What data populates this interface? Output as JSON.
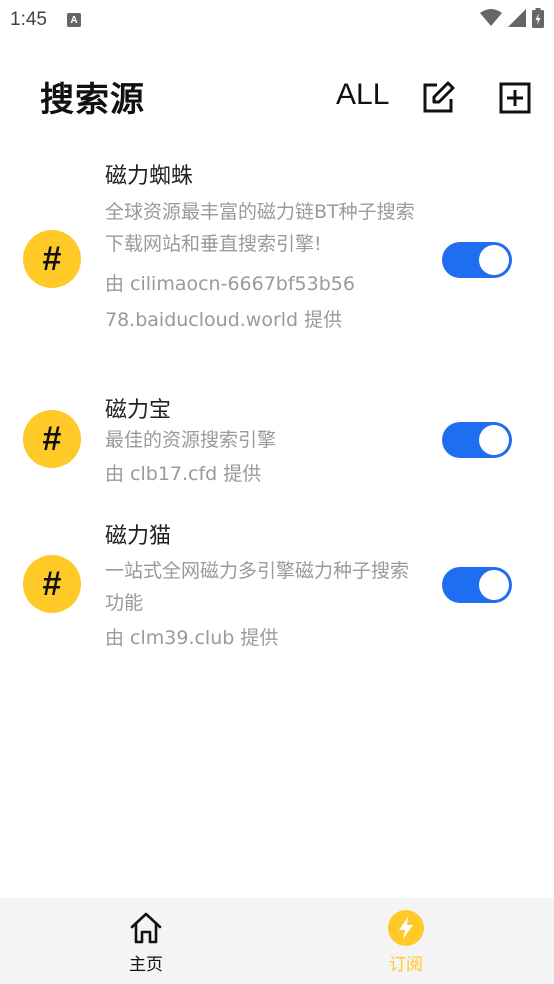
{
  "status_bar": {
    "time": "1:45",
    "notification_glyph": "A"
  },
  "header": {
    "title": "搜索源",
    "all_label": "ALL"
  },
  "sources": [
    {
      "icon_glyph": "#",
      "name": "磁力蜘蛛",
      "description": "全球资源最丰富的磁力链BT种子搜索下载网站和垂直搜索引擎!",
      "provider": "由 cilimaocn-6667bf53b5678.baiducloud.world 提供",
      "enabled": true
    },
    {
      "icon_glyph": "#",
      "name": "磁力宝",
      "description": "最佳的资源搜索引擎",
      "provider": "由 clb17.cfd 提供",
      "enabled": true
    },
    {
      "icon_glyph": "#",
      "name": "磁力猫",
      "description": "一站式全网磁力多引擎磁力种子搜索功能",
      "provider": "由 clm39.club 提供",
      "enabled": true
    }
  ],
  "bottom_nav": {
    "items": [
      {
        "label": "主页",
        "icon": "home-icon",
        "active": false
      },
      {
        "label": "订阅",
        "icon": "lightning-icon",
        "active": true
      }
    ]
  },
  "colors": {
    "accent": "#1f6ef2",
    "avatar": "#ffc928",
    "active_nav": "#ffc928",
    "secondary_text": "#9a9a9a"
  }
}
